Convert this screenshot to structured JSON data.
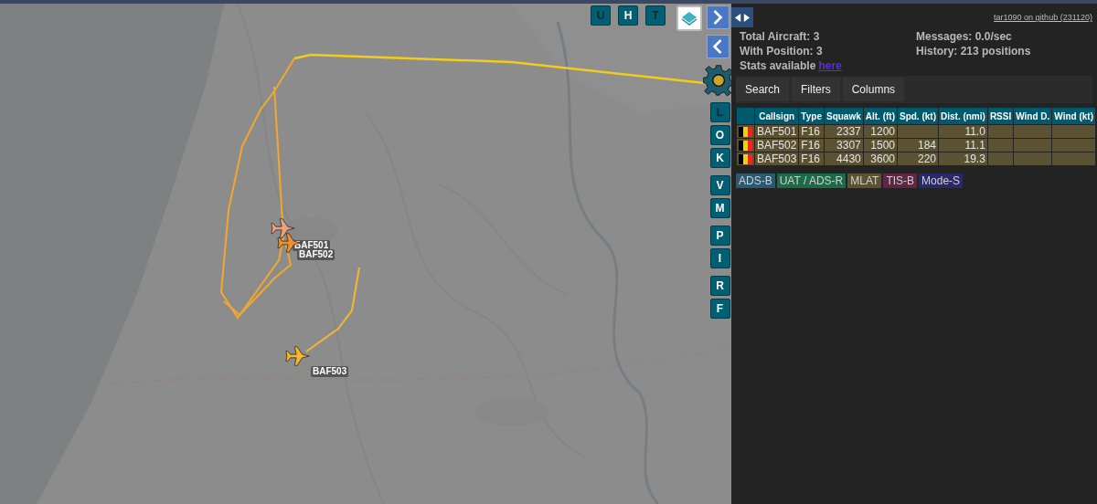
{
  "map": {
    "top_buttons": [
      {
        "label": "U",
        "active": true
      },
      {
        "label": "H",
        "active": false
      },
      {
        "label": "T",
        "active": true
      }
    ],
    "side_button_groups": [
      [
        {
          "label": "L",
          "active": true
        },
        {
          "label": "O",
          "active": false
        },
        {
          "label": "K",
          "active": false
        }
      ],
      [
        {
          "label": "V",
          "active": false
        },
        {
          "label": "M",
          "active": false
        }
      ],
      [
        {
          "label": "P",
          "active": false
        },
        {
          "label": "I",
          "active": false
        }
      ],
      [
        {
          "label": "R",
          "active": false
        },
        {
          "label": "F",
          "active": false
        }
      ]
    ],
    "aircraft": [
      {
        "label": "BAF501",
        "color": "#e8a27e"
      },
      {
        "label": "BAF502",
        "color": "#f0902a"
      },
      {
        "label": "BAF503",
        "color": "#f5b730"
      }
    ]
  },
  "panel": {
    "github_link": "tar1090 on github (231120)",
    "stats": [
      {
        "label": "Total Aircraft: 3"
      },
      {
        "label": "Messages: 0.0/sec"
      },
      {
        "label": "With Position: 3"
      },
      {
        "label": "History: 213 positions"
      }
    ],
    "stats_note": "Stats available",
    "stats_link": "here",
    "tabs": [
      "Search",
      "Filters",
      "Columns"
    ],
    "table": {
      "columns": [
        "Callsign",
        "Type",
        "Squawk",
        "Alt. (ft)",
        "Spd. (kt)",
        "Dist. (nmi)",
        "RSSI",
        "Wind D.",
        "Wind (kt)"
      ],
      "rows": [
        {
          "callsign": "BAF501",
          "type": "F16",
          "squawk": "2337",
          "alt": "1200",
          "dist": "11.0"
        },
        {
          "callsign": "BAF502",
          "type": "F16",
          "squawk": "3307",
          "alt": "1500",
          "spd": "184",
          "dist": "11.1"
        },
        {
          "callsign": "BAF503",
          "type": "F16",
          "squawk": "4430",
          "alt": "3600",
          "spd": "220",
          "dist": "19.3"
        }
      ]
    },
    "legend": [
      {
        "label": "ADS-B",
        "color": "#2b5a70"
      },
      {
        "label": "UAT / ADS-R",
        "color": "#1e6a48"
      },
      {
        "label": "MLAT",
        "color": "#5a5233"
      },
      {
        "label": "TIS-B",
        "color": "#5c2843"
      },
      {
        "label": "Mode-S",
        "color": "#2a2966"
      }
    ]
  }
}
